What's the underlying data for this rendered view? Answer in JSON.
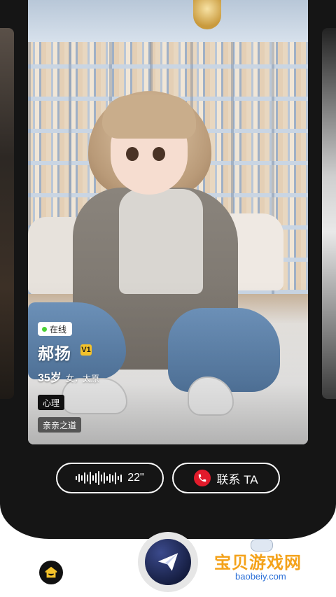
{
  "profile": {
    "status": "在线",
    "name": "郝扬",
    "vip_mark": "V1",
    "age": "35岁",
    "info": "女，太原",
    "tags": [
      "心理",
      "亲亲之道"
    ]
  },
  "actions": {
    "voice_duration": "22\"",
    "contact_label": "联系 TA"
  },
  "watermark": {
    "title": "宝贝游戏网",
    "url": "baobeiy.com"
  },
  "icons": {
    "home": "home-icon",
    "send": "paper-plane-icon",
    "phone": "phone-icon",
    "voice": "sound-wave-icon"
  },
  "colors": {
    "online": "#4cd137",
    "vip": "#f4c22b",
    "call": "#e21b2b",
    "panel": "#151515"
  }
}
